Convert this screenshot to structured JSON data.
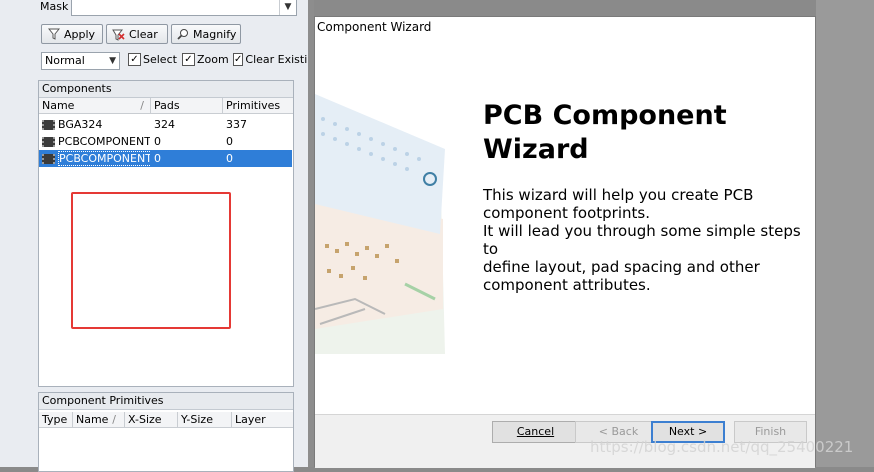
{
  "mask": {
    "label": "Mask",
    "value": ""
  },
  "toolbar": {
    "apply": "Apply",
    "clear": "Clear",
    "magnify": "Magnify"
  },
  "filter": {
    "mode": "Normal",
    "select_label": "Select",
    "zoom_label": "Zoom",
    "clear_label": "Clear Existin"
  },
  "components_panel": {
    "title": "Components",
    "columns": [
      "Name",
      "Pads",
      "Primitives"
    ],
    "rows": [
      {
        "name": "BGA324",
        "pads": "324",
        "primitives": "337",
        "selected": false
      },
      {
        "name": "PCBCOMPONENT_",
        "pads": "0",
        "primitives": "0",
        "selected": false
      },
      {
        "name": "PCBCOMPONENT_",
        "pads": "0",
        "primitives": "0",
        "selected": true
      }
    ]
  },
  "primitives_panel": {
    "title": "Component Primitives",
    "columns": [
      "Type",
      "Name",
      "X-Size",
      "Y-Size",
      "Layer"
    ]
  },
  "wizard": {
    "title": "Component Wizard",
    "heading_line1": "PCB Component",
    "heading_line2": "Wizard",
    "desc_line1": "This wizard will help you create PCB",
    "desc_line2": "component footprints.",
    "desc_line3": "It will lead you through some simple steps to",
    "desc_line4": "define layout, pad spacing and other",
    "desc_line5": "component attributes.",
    "buttons": {
      "cancel": "Cancel",
      "back": "< Back",
      "next": "Next >",
      "finish": "Finish"
    }
  },
  "watermark": "https://blog.csdn.net/qq_25400221",
  "colors": {
    "selection": "#2f7ed8",
    "annotation_red": "#e53935"
  }
}
